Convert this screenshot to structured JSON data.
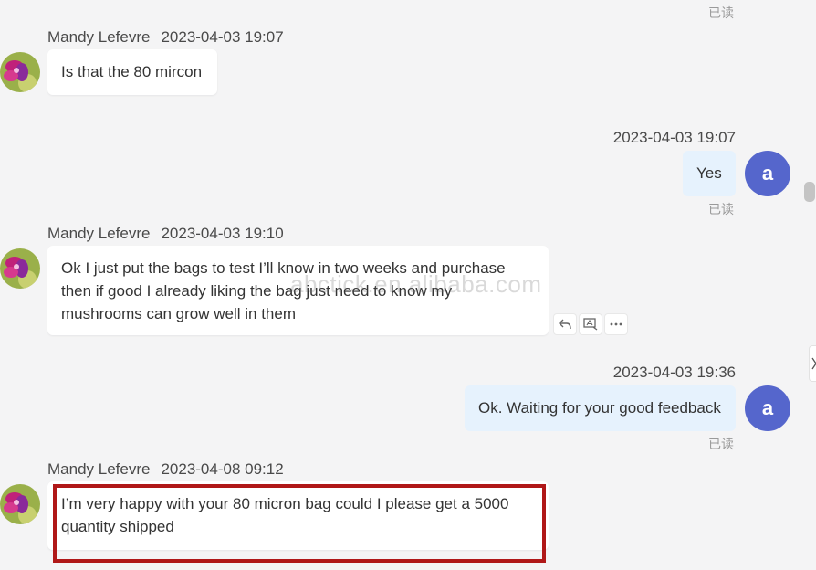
{
  "read_status": "已读",
  "watermark": "abctick.en.alibaba.com",
  "colors": {
    "highlight": "#b01818",
    "avatar_a": "#5566cc",
    "outgoing_bubble": "#e6f2fd"
  },
  "messages": [
    {
      "sender": "Mandy Lefevre",
      "time": "2023-04-03 19:07",
      "text": "Is that the 80 mircon"
    },
    {
      "time": "2023-04-03 19:07",
      "avatar_initial": "a",
      "text": "Yes",
      "status": "已读"
    },
    {
      "sender": "Mandy Lefevre",
      "time": "2023-04-03 19:10",
      "line1": "Ok I just put the bags to test I’ll know in two weeks and purchase",
      "line2": "then if good I already liking the bag just need to know my",
      "line3": "mushrooms can grow well in them"
    },
    {
      "time": "2023-04-03 19:36",
      "avatar_initial": "a",
      "text": "Ok. Waiting for your good feedback",
      "status": "已读"
    },
    {
      "sender": "Mandy Lefevre",
      "time": "2023-04-08 09:12",
      "line1": "I’m very happy with your 80 micron bag could I please get a 5000",
      "line2": "quantity shipped"
    }
  ],
  "actions": [
    {
      "icon": "reply-icon"
    },
    {
      "icon": "translate-icon"
    },
    {
      "icon": "more-icon"
    }
  ]
}
